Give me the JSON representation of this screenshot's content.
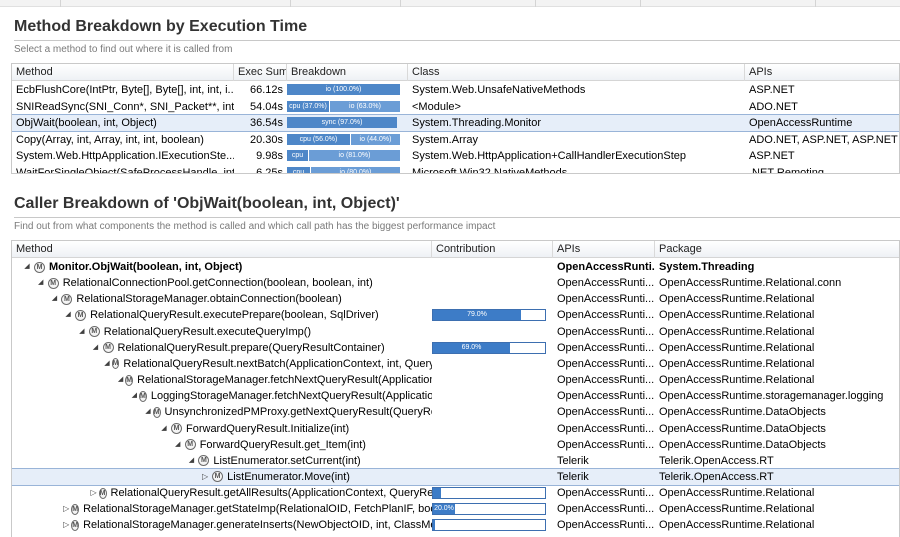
{
  "method_section": {
    "title": "Method Breakdown by Execution Time",
    "subtitle": "Select a method to find out where it is called from",
    "columns": [
      "Method",
      "Exec Sum",
      "Breakdown",
      "Class",
      "APIs"
    ],
    "rows": [
      {
        "method": "EcbFlushCore(IntPtr, Byte[], Byte[], int, int, i...",
        "exec": "66.12s",
        "segments": [
          {
            "label": "io (100.0%)",
            "fraction": 1.0
          }
        ],
        "class": "System.Web.UnsafeNativeMethods",
        "apis": "ASP.NET"
      },
      {
        "method": "SNIReadSync(SNI_Conn*, SNI_Packet**, int)",
        "exec": "54.04s",
        "segments": [
          {
            "label": "cpu (37.0%)",
            "fraction": 0.37
          },
          {
            "label": "io (63.0%)",
            "fraction": 0.63
          }
        ],
        "class": "<Module>",
        "apis": "ADO.NET"
      },
      {
        "method": "ObjWait(boolean, int, Object)",
        "exec": "36.54s",
        "segments": [
          {
            "label": "sync (97.0%)",
            "fraction": 0.97
          }
        ],
        "class": "System.Threading.Monitor",
        "apis": "OpenAccessRuntime",
        "selected": true
      },
      {
        "method": "Copy(Array, int, Array, int, int, boolean)",
        "exec": "20.30s",
        "segments": [
          {
            "label": "cpu (56.0%)",
            "fraction": 0.56
          },
          {
            "label": "io (44.0%)",
            "fraction": 0.44
          }
        ],
        "class": "System.Array",
        "apis": "ADO.NET, ASP.NET, ASP.NET ..."
      },
      {
        "method": "System.Web.HttpApplication.IExecutionSte...",
        "exec": "9.98s",
        "segments": [
          {
            "label": "cpu",
            "fraction": 0.19
          },
          {
            "label": "io (81.0%)",
            "fraction": 0.81
          }
        ],
        "class": "System.Web.HttpApplication+CallHandlerExecutionStep",
        "apis": "ASP.NET"
      },
      {
        "method": "WaitForSingleObject(SafeProcessHandle, int)",
        "exec": "6.25s",
        "segments": [
          {
            "label": "cpu",
            "fraction": 0.2
          },
          {
            "label": "io (80.0%)",
            "fraction": 0.8
          }
        ],
        "class": "Microsoft.Win32.NativeMethods",
        "apis": ".NET Remoting"
      }
    ]
  },
  "caller_section": {
    "title": "Caller Breakdown of 'ObjWait(boolean, int, Object)'",
    "subtitle": "Find out from what components the method is called and which call path has the biggest performance impact",
    "columns": [
      "Method",
      "Contribution",
      "APIs",
      "Package"
    ],
    "rows": [
      {
        "depth": 0,
        "expander": "expanded",
        "method": "Monitor.ObjWait(boolean, int, Object)",
        "apis": "OpenAccessRunti...",
        "package": "System.Threading",
        "bold": true
      },
      {
        "depth": 1,
        "expander": "expanded",
        "method": "RelationalConnectionPool.getConnection(boolean, boolean, int)",
        "apis": "OpenAccessRunti...",
        "package": "OpenAccessRuntime.Relational.conn"
      },
      {
        "depth": 2,
        "expander": "expanded",
        "method": "RelationalStorageManager.obtainConnection(boolean)",
        "apis": "OpenAccessRunti...",
        "package": "OpenAccessRuntime.Relational"
      },
      {
        "depth": 3,
        "expander": "expanded",
        "method": "RelationalQueryResult.executePrepare(boolean, SqlDriver)",
        "apis": "OpenAccessRunti...",
        "package": "OpenAccessRuntime.Relational",
        "contribution": {
          "label": "79.0%",
          "fraction": 0.79
        }
      },
      {
        "depth": 4,
        "expander": "expanded",
        "method": "RelationalQueryResult.executeQueryImp()",
        "apis": "OpenAccessRunti...",
        "package": "OpenAccessRuntime.Relational"
      },
      {
        "depth": 5,
        "expander": "expanded",
        "method": "RelationalQueryResult.prepare(QueryResultContainer)",
        "apis": "OpenAccessRunti...",
        "package": "OpenAccessRuntime.Relational",
        "contribution": {
          "label": "69.0%",
          "fraction": 0.69
        }
      },
      {
        "depth": 6,
        "expander": "expanded",
        "method": "RelationalQueryResult.nextBatch(ApplicationContext, int, QueryR",
        "apis": "OpenAccessRunti...",
        "package": "OpenAccessRuntime.Relational"
      },
      {
        "depth": 7,
        "expander": "expanded",
        "method": "RelationalStorageManager.fetchNextQueryResult(ApplicationC",
        "apis": "OpenAccessRunti...",
        "package": "OpenAccessRuntime.Relational"
      },
      {
        "depth": 8,
        "expander": "expanded",
        "method": "LoggingStorageManager.fetchNextQueryResult(Application",
        "apis": "OpenAccessRunti...",
        "package": "OpenAccessRuntime.storagemanager.logging"
      },
      {
        "depth": 9,
        "expander": "expanded",
        "method": "UnsynchronizedPMProxy.getNextQueryResult(QueryRes",
        "apis": "OpenAccessRunti...",
        "package": "OpenAccessRuntime.DataObjects"
      },
      {
        "depth": 10,
        "expander": "expanded",
        "method": "ForwardQueryResult.Initialize(int)",
        "apis": "OpenAccessRunti...",
        "package": "OpenAccessRuntime.DataObjects"
      },
      {
        "depth": 11,
        "expander": "expanded",
        "method": "ForwardQueryResult.get_Item(int)",
        "apis": "OpenAccessRunti...",
        "package": "OpenAccessRuntime.DataObjects"
      },
      {
        "depth": 12,
        "expander": "expanded",
        "method": "ListEnumerator.setCurrent(int)",
        "apis": "Telerik",
        "package": "Telerik.OpenAccess.RT"
      },
      {
        "depth": 13,
        "expander": "collapsed",
        "method": "ListEnumerator.Move(int)",
        "apis": "Telerik",
        "package": "Telerik.OpenAccess.RT",
        "selected": true
      },
      {
        "depth": 5,
        "expander": "collapsed",
        "method": "RelationalQueryResult.getAllResults(ApplicationContext, QueryResul",
        "apis": "OpenAccessRunti...",
        "package": "OpenAccessRuntime.Relational",
        "contribution": {
          "label": "",
          "fraction": 0.07
        }
      },
      {
        "depth": 3,
        "expander": "collapsed",
        "method": "RelationalStorageManager.getStateImp(RelationalOID, FetchPlanIF, boolea",
        "apis": "OpenAccessRunti...",
        "package": "OpenAccessRuntime.Relational",
        "contribution": {
          "label": "20.0%",
          "fraction": 0.2
        }
      },
      {
        "depth": 3,
        "expander": "collapsed",
        "method": "RelationalStorageManager.generateInserts(NewObjectOID, int, ClassMetaD",
        "apis": "OpenAccessRunti...",
        "package": "OpenAccessRuntime.Relational",
        "contribution": {
          "label": "",
          "fraction": 0.01
        }
      }
    ]
  },
  "icons": {
    "tree_method": "method-circle-icon",
    "expand": "triangle-down-icon",
    "collapse": "triangle-right-icon"
  }
}
